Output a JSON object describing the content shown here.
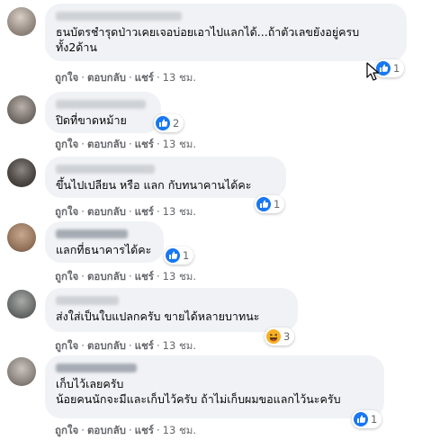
{
  "colors": {
    "bubble": "#f0f2f5",
    "meta_text": "#65676b",
    "like_blue": "#1877f2",
    "haha_yellow": "#f7b125"
  },
  "actions_labels": {
    "like": "ถูกใจ",
    "reply": "ตอบกลับ",
    "share": "แชร์",
    "separator": "·"
  },
  "comments": [
    {
      "text": "ธนบัตรชำรุดป่าวเคยเจอบ่อยเอาไปแลกได้...ถ้าตัวเลขยังอยู่ครบ\nทั้ง2ด้าน",
      "reaction": {
        "icon": "like-icon",
        "count": "1"
      },
      "time": "13 ชม."
    },
    {
      "text": "ปิดที่ขาดหม้าย",
      "reaction": {
        "icon": "like-icon",
        "count": "2"
      },
      "time": "13 ชม."
    },
    {
      "text": "ขึ้นไปเปลียน หรือ แลก กับทนาคานได้คะ",
      "reaction": {
        "icon": "like-icon",
        "count": "1"
      },
      "time": "13 ชม."
    },
    {
      "text": "แลกที่ธนาคารได้คะ",
      "reaction": {
        "icon": "like-icon",
        "count": "1"
      },
      "time": "13 ชม."
    },
    {
      "text": "ส่งใส่เป็นใบแปลกครับ ขายได้หลายบาทนะ",
      "reaction": {
        "icon": "haha-icon",
        "count": "3"
      },
      "time": "13 ชม."
    },
    {
      "text": "เก็บไว้เลยครับ\nน้อยคนนักจะมีและเก็บไว้ครับ ถ้าไม่เก็บผมขอแลกไว้นะครับ",
      "reaction": {
        "icon": "like-icon",
        "count": "1"
      },
      "time": "13 ชม."
    }
  ]
}
